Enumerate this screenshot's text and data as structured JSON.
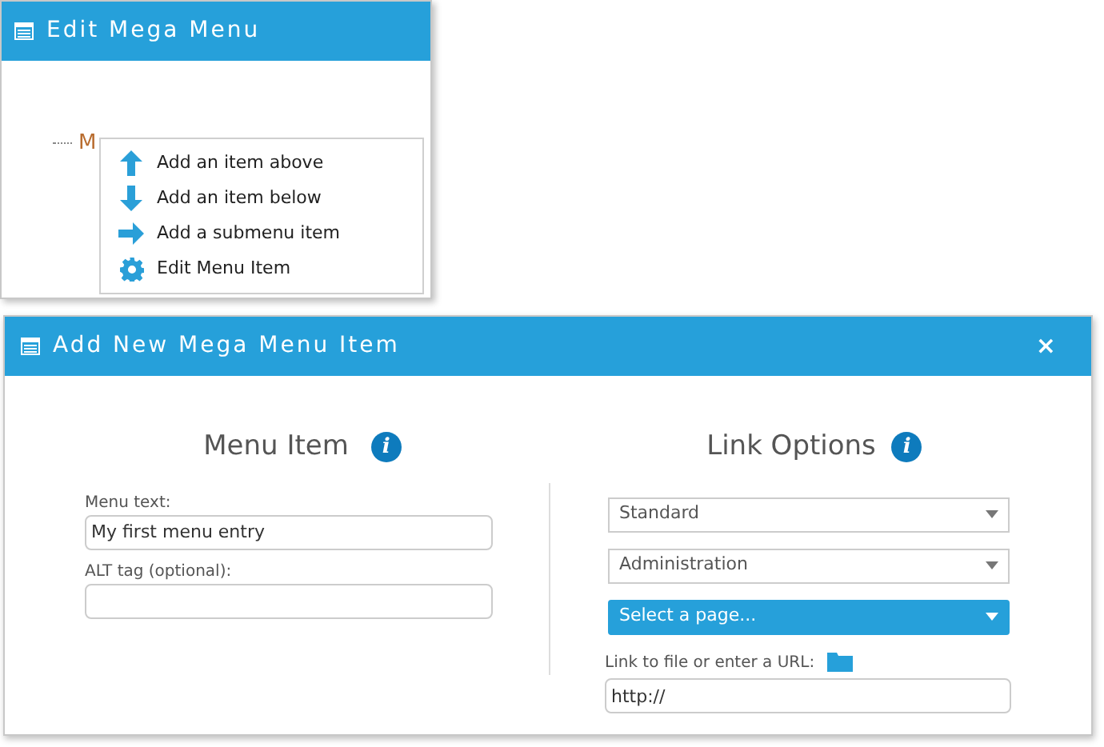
{
  "edit_window": {
    "title": "Edit Mega Menu",
    "tree": [
      {
        "label": "M"
      }
    ],
    "context_menu": [
      {
        "kind": "up",
        "label": "Add an item above"
      },
      {
        "kind": "down",
        "label": "Add an item below"
      },
      {
        "kind": "right",
        "label": "Add a submenu item"
      },
      {
        "kind": "gear",
        "label": "Edit Menu Item"
      }
    ]
  },
  "dialog": {
    "title": "Add New Mega Menu Item",
    "close": "×",
    "menu_item": {
      "heading": "Menu Item",
      "info": "i",
      "fields": [
        {
          "label": "Menu text:",
          "value": "My first menu entry"
        },
        {
          "label": "ALT tag (optional):"
        }
      ]
    },
    "link_options": {
      "heading": "Link Options",
      "info": "i",
      "selects": [
        {
          "value": "Standard",
          "highlighted": false
        },
        {
          "value": "Administration",
          "highlighted": false
        },
        {
          "value": "Select a page...",
          "highlighted": true
        }
      ],
      "url": {
        "label": "Link to file or enter a URL:",
        "value": "http://"
      }
    }
  }
}
